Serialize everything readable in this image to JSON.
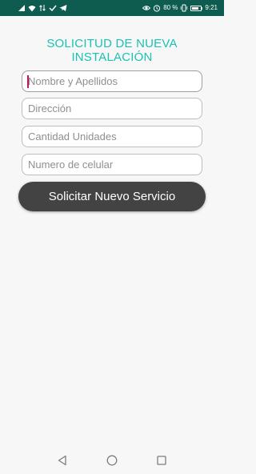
{
  "status_bar": {
    "battery_text": "80 %",
    "battery_level": 0.8,
    "time": "9:21",
    "icons": [
      "signal-icon",
      "wifi-icon",
      "data-arrows-icon",
      "check-icon",
      "telegram-icon",
      "eye-icon",
      "alarm-icon",
      "vibrate-icon",
      "battery-icon"
    ]
  },
  "form": {
    "title_line1": "SOLICITUD DE NUEVA",
    "title_line2": "INSTALACIÓN",
    "fields": [
      {
        "placeholder": "Nombre y Apellidos",
        "value": ""
      },
      {
        "placeholder": "Dirección",
        "value": ""
      },
      {
        "placeholder": "Cantidad Unidades",
        "value": ""
      },
      {
        "placeholder": "Numero de celular",
        "value": ""
      }
    ],
    "submit_label": "Solicitar Nuevo Servicio"
  },
  "nav_bar": {
    "icons": [
      "back-icon",
      "home-icon",
      "recents-icon"
    ]
  },
  "colors": {
    "status_bar_bg": "#0d5c4f",
    "title": "#19c2b3",
    "button_bg": "#434343",
    "caret": "#c2185b",
    "page_bg": "#f7f7f7"
  }
}
